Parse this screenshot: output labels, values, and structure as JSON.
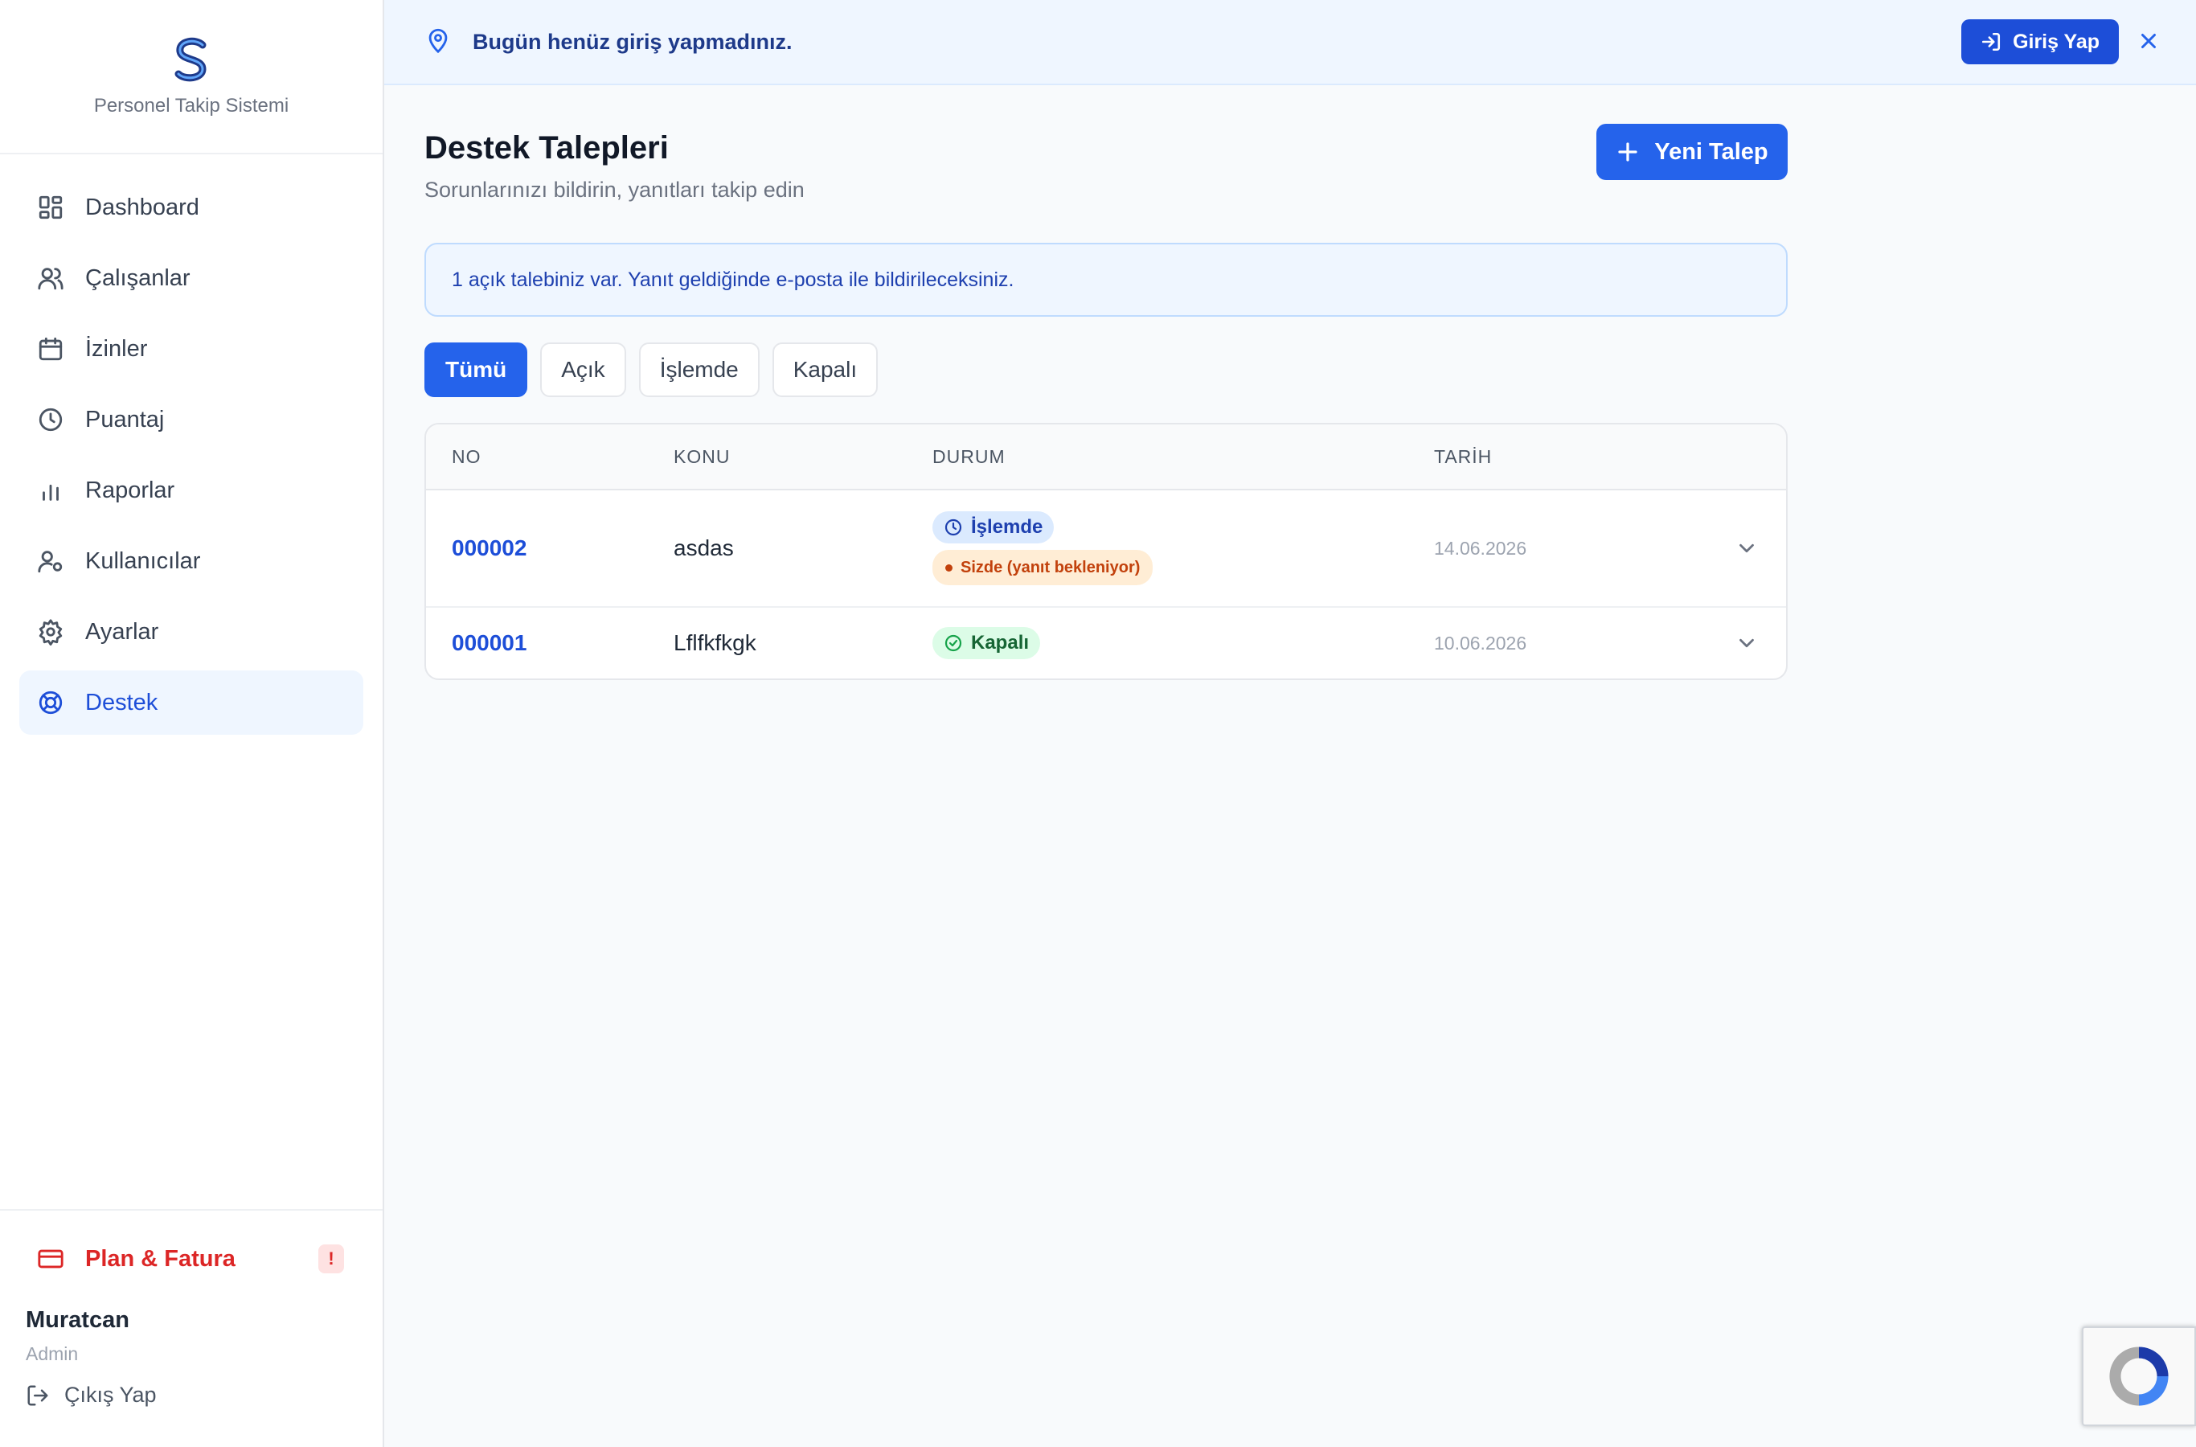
{
  "brand": {
    "name": "Personel Takip Sistemi"
  },
  "sidebar": {
    "items": [
      {
        "label": "Dashboard",
        "icon": "dashboard-icon"
      },
      {
        "label": "Çalışanlar",
        "icon": "users-icon"
      },
      {
        "label": "İzinler",
        "icon": "calendar-icon"
      },
      {
        "label": "Puantaj",
        "icon": "clock-icon"
      },
      {
        "label": "Raporlar",
        "icon": "bar-chart-icon"
      },
      {
        "label": "Kullanıcılar",
        "icon": "user-gear-icon"
      },
      {
        "label": "Ayarlar",
        "icon": "gear-icon"
      },
      {
        "label": "Destek",
        "icon": "lifebuoy-icon",
        "active": true
      }
    ],
    "plan": {
      "label": "Plan & Fatura",
      "badge": "!"
    },
    "user": {
      "name": "Muratcan",
      "role": "Admin"
    },
    "logout_label": "Çıkış Yap"
  },
  "banner": {
    "text": "Bugün henüz giriş yapmadınız.",
    "button_label": "Giriş Yap"
  },
  "page": {
    "title": "Destek Talepleri",
    "subtitle": "Sorunlarınızı bildirin, yanıtları takip edin",
    "new_button": "Yeni Talep",
    "info": "1 açık talebiniz var. Yanıt geldiğinde e-posta ile bildirileceksiniz."
  },
  "filters": [
    {
      "label": "Tümü",
      "active": true
    },
    {
      "label": "Açık"
    },
    {
      "label": "İşlemde"
    },
    {
      "label": "Kapalı"
    }
  ],
  "table": {
    "headers": [
      "NO",
      "KONU",
      "DURUM",
      "TARİH"
    ],
    "rows": [
      {
        "no": "000002",
        "konu": "asdas",
        "status": "İşlemde",
        "substatus": "Sizde (yanıt bekleniyor)",
        "date": "14.06.2026"
      },
      {
        "no": "000001",
        "konu": "Lflfkfkgk",
        "status": "Kapalı",
        "date": "10.06.2026"
      }
    ]
  },
  "colors": {
    "accent": "#2563eb",
    "danger": "#dc2626",
    "success": "#166534",
    "warning": "#c2410c"
  }
}
